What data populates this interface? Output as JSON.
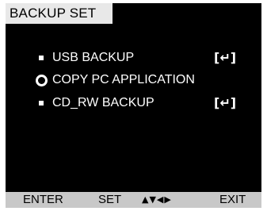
{
  "header": {
    "title": "BACKUP SET"
  },
  "menu": {
    "items": [
      {
        "label": "USB BACKUP",
        "bullet": "square-bullet-icon",
        "action_glyph": "[↵]",
        "action_icon": "enter-key-icon"
      },
      {
        "label": "COPY PC APPLICATION",
        "bullet": "selected-ring-icon",
        "selected": true
      },
      {
        "label": "CD_RW BACKUP",
        "bullet": "square-bullet-icon",
        "action_glyph": "[↵]",
        "action_icon": "enter-key-icon"
      }
    ]
  },
  "footer": {
    "enter_label": "ENTER",
    "set_label": "SET",
    "arrows_label": "▲▼◀▶",
    "exit_label": "EXIT"
  },
  "colors": {
    "background": "#000000",
    "text": "#ffffff",
    "title_bg": "#e8e8e8",
    "footer_bg": "#c8c8c8"
  }
}
